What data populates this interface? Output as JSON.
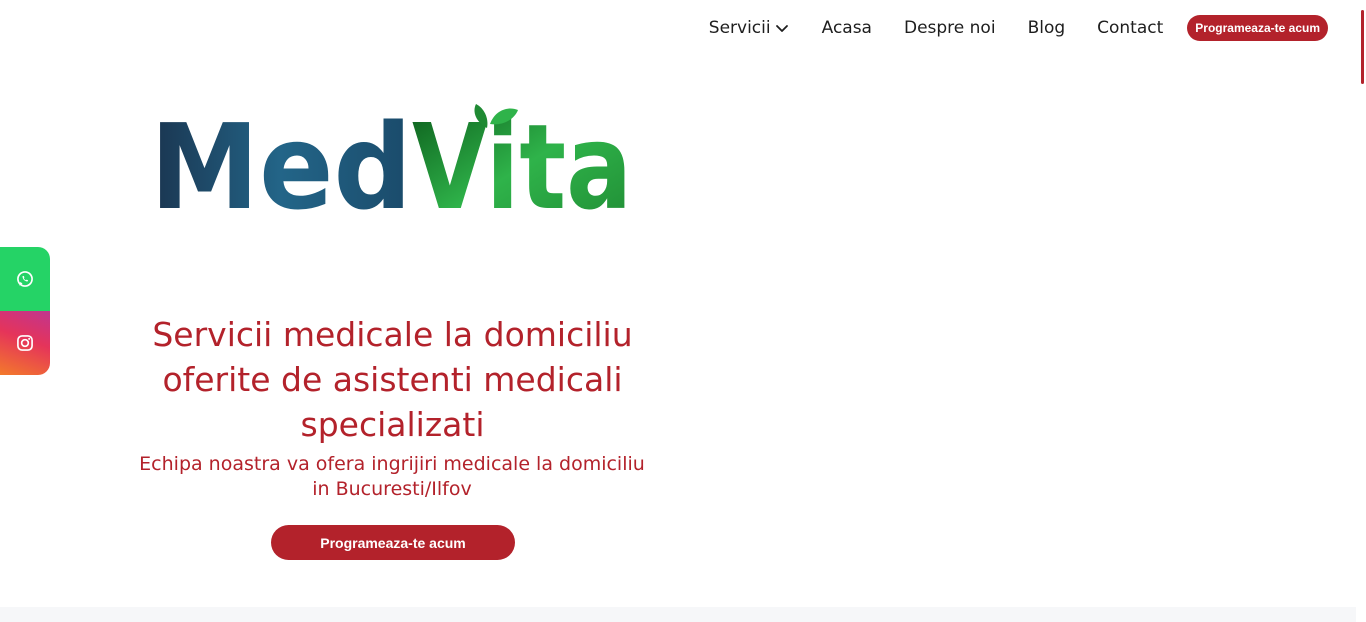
{
  "brand": {
    "name_part1": "Med",
    "name_part2": "Vita",
    "colors": {
      "primary": "#b3222b",
      "logo_blue": "#1f4b6b",
      "logo_green": "#2fb34a"
    }
  },
  "nav": {
    "items": [
      {
        "label": "Servicii",
        "has_dropdown": true
      },
      {
        "label": "Acasa"
      },
      {
        "label": "Despre noi"
      },
      {
        "label": "Blog"
      },
      {
        "label": "Contact"
      }
    ],
    "cta_label": "Programeaza-te acum",
    "dropdown_icon": "chevron-down-icon"
  },
  "social": {
    "items": [
      {
        "name": "whatsapp",
        "icon": "whatsapp-icon",
        "color": "#25d366"
      },
      {
        "name": "instagram",
        "icon": "instagram-icon",
        "color": "#e1306c"
      }
    ]
  },
  "hero": {
    "title_lines": [
      "Servicii medicale la domiciliu",
      "oferite de asistenti medicali",
      "specializati"
    ],
    "subtitle_lines": [
      "Echipa noastra va ofera ingrijiri medicale la domiciliu",
      "in Bucuresti/Ilfov"
    ],
    "cta_label": "Programeaza-te acum"
  }
}
